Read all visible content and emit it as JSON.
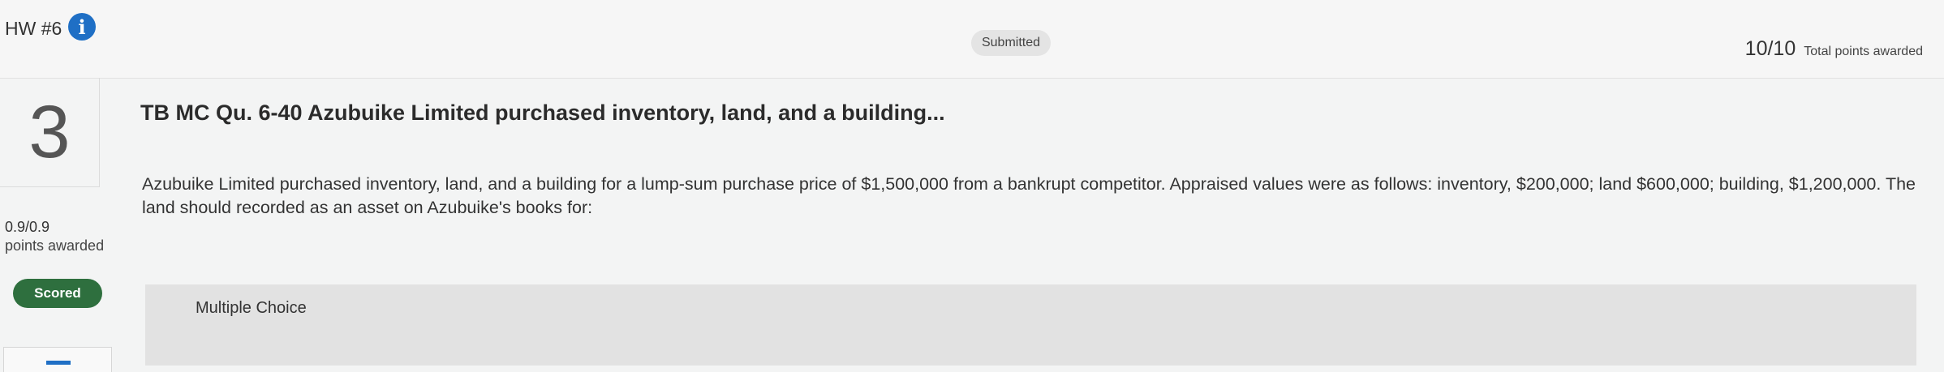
{
  "header": {
    "assignment_title": "HW #6",
    "status": "Submitted",
    "total_points_value": "10/10",
    "total_points_label": "Total points awarded"
  },
  "question": {
    "number": "3",
    "title": "TB MC Qu. 6-40 Azubuike Limited purchased inventory, land, and a building...",
    "body": "Azubuike Limited purchased inventory, land, and a building for a lump-sum purchase price of $1,500,000 from a bankrupt competitor. Appraised values were as follows: inventory, $200,000; land $600,000; building, $1,200,000. The land should recorded as an asset on Azubuike's books for:",
    "points_value": "0.9/0.9",
    "points_label": "points awarded",
    "scored_label": "Scored",
    "answer_type": "Multiple Choice"
  },
  "colors": {
    "info_icon": "#1f6fc5",
    "scored_badge": "#2e6f3e",
    "answer_panel": "#e2e2e2"
  },
  "icons": {
    "info": "info-icon"
  }
}
